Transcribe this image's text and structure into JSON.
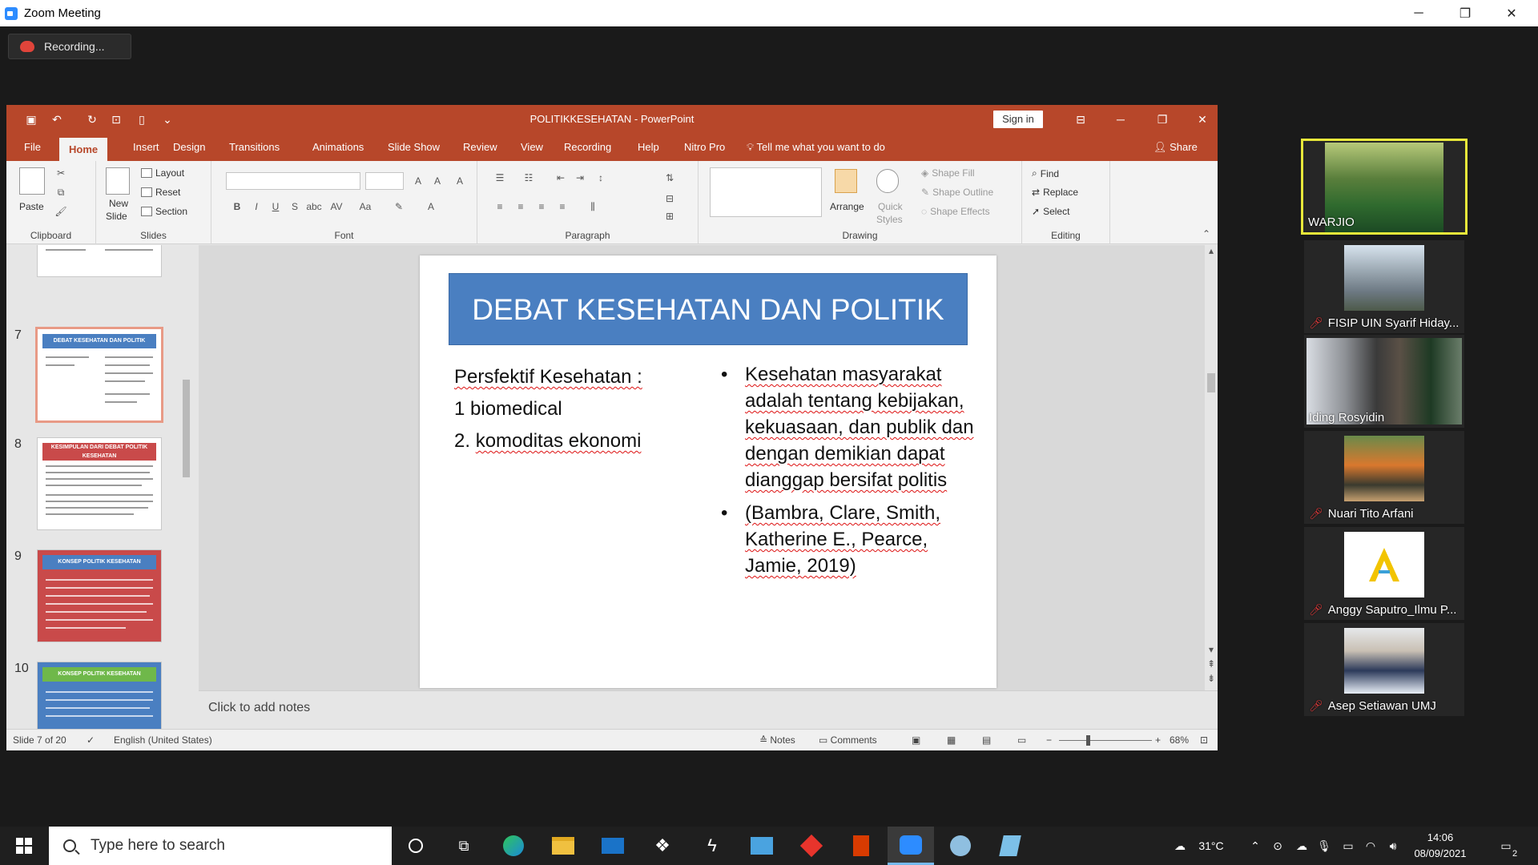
{
  "zoom": {
    "window_title": "Zoom Meeting",
    "recording_label": "Recording..."
  },
  "ppt": {
    "doc_title": "POLITIKKESEHATAN  -  PowerPoint",
    "sign_in": "Sign in",
    "tabs": [
      "File",
      "Home",
      "Insert",
      "Design",
      "Transitions",
      "Animations",
      "Slide Show",
      "Review",
      "View",
      "Recording",
      "Help",
      "Nitro Pro"
    ],
    "tell_me": "Tell me what you want to do",
    "share": "Share",
    "ribbon": {
      "clipboard": {
        "label": "Clipboard",
        "paste": "Paste"
      },
      "slides": {
        "label": "Slides",
        "new_slide": "New",
        "new_slide2": "Slide",
        "layout": "Layout",
        "reset": "Reset",
        "section": "Section"
      },
      "font": {
        "label": "Font"
      },
      "paragraph": {
        "label": "Paragraph"
      },
      "drawing": {
        "label": "Drawing",
        "arrange": "Arrange",
        "quick_styles": "Quick",
        "quick_styles2": "Styles",
        "shape_fill": "Shape Fill",
        "shape_outline": "Shape Outline",
        "shape_effects": "Shape Effects"
      },
      "editing": {
        "label": "Editing",
        "find": "Find",
        "replace": "Replace",
        "select": "Select"
      }
    },
    "thumbnails": [
      {
        "num": "7",
        "title": "DEBAT KESEHATAN DAN POLITIK",
        "color": "#4a7fc1"
      },
      {
        "num": "8",
        "title": "KESIMPULAN DARI DEBAT POLITIK KESEHATAN",
        "color": "#c94a4a"
      },
      {
        "num": "9",
        "title": "KONSEP POLITIK KESEHATAN",
        "color": "#4a7fc1"
      },
      {
        "num": "10",
        "title": "KONSEP POLITIK KESEHATAN",
        "color": "#6fb84a"
      }
    ],
    "slide": {
      "title": "DEBAT KESEHATAN DAN POLITIK",
      "left": {
        "heading": "Persfektif Kesehatan :",
        "item1": "1 biomedical",
        "item2_num": "2.",
        "item2_text": "komoditas ekonomi"
      },
      "bullets": [
        "Kesehatan masyarakat adalah tentang kebijakan, kekuasaan, dan publik dan dengan demikian dapat dianggap bersifat politis",
        "(Bambra, Clare, Smith, Katherine E., Pearce, Jamie, 2019)"
      ]
    },
    "notes_placeholder": "Click to add notes",
    "status": {
      "slide_of": "Slide 7 of 20",
      "language": "English (United States)",
      "notes": "Notes",
      "comments": "Comments",
      "zoom": "68%"
    }
  },
  "participants": [
    {
      "name": "WARJIO",
      "muted": false,
      "speaking": true
    },
    {
      "name": "FISIP UIN Syarif Hiday...",
      "muted": true,
      "speaking": false
    },
    {
      "name": "Iding Rosyidin",
      "muted": false,
      "speaking": false
    },
    {
      "name": "Nuari Tito Arfani",
      "muted": true,
      "speaking": false
    },
    {
      "name": "Anggy Saputro_Ilmu P...",
      "muted": true,
      "speaking": false
    },
    {
      "name": "Asep Setiawan UMJ",
      "muted": true,
      "speaking": false
    }
  ],
  "taskbar": {
    "search_placeholder": "Type here to search",
    "temperature": "31°C",
    "time": "14:06",
    "date": "08/09/2021",
    "notification_count": "2"
  }
}
